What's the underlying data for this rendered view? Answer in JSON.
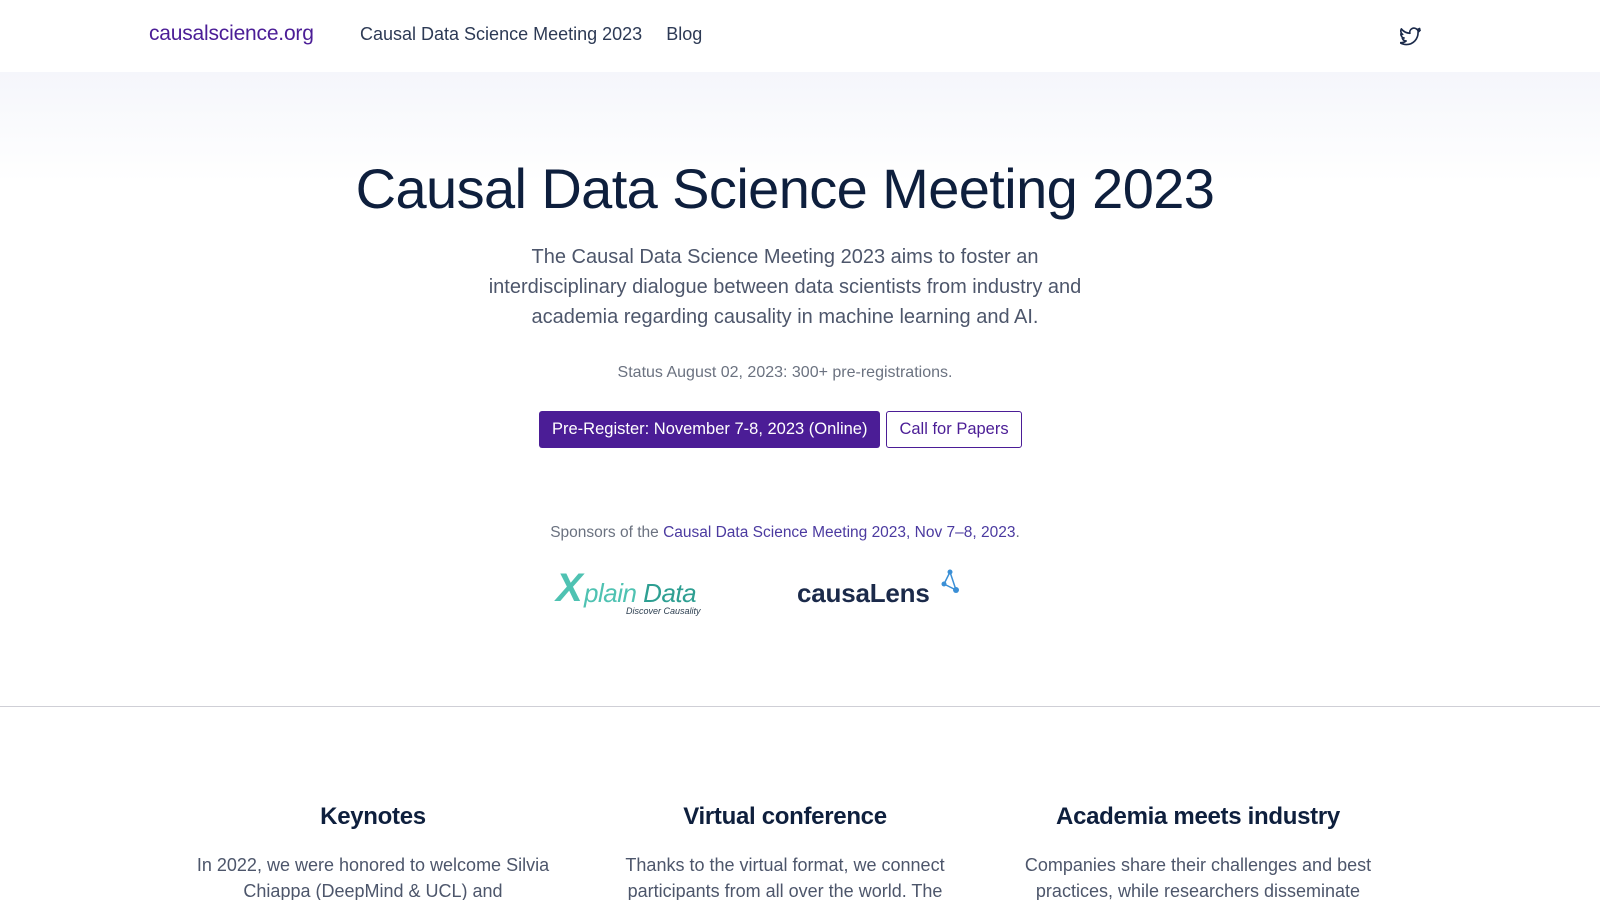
{
  "header": {
    "brand": "causalscience.org",
    "nav": [
      "Causal Data Science Meeting 2023",
      "Blog"
    ],
    "social_icon": "twitter-icon"
  },
  "hero": {
    "title": "Causal Data Science Meeting 2023",
    "description": "The Causal Data Science Meeting 2023 aims to foster an interdisciplinary dialogue between data scientists from industry and academia regarding causality in machine learning and AI.",
    "status": "Status August 02, 2023: 300+ pre-registrations.",
    "primary_button": "Pre-Register: November 7-8, 2023 (Online)",
    "secondary_button": "Call for Papers",
    "sponsors_prefix": "Sponsors of the ",
    "sponsors_link": "Causal Data Science Meeting 2023, Nov 7–8, 2023",
    "sponsors_suffix": "."
  },
  "sponsors": [
    {
      "name": "Xplain Data",
      "x": "X",
      "rest": "plain",
      "data_word": "Data",
      "tagline": "Discover Causality"
    },
    {
      "name": "causaLens",
      "word": "causaLens"
    }
  ],
  "features": [
    {
      "title": "Keynotes",
      "text": "In 2022, we were honored to welcome Silvia Chiappa (DeepMind & UCL) and"
    },
    {
      "title": "Virtual conference",
      "text": "Thanks to the virtual format, we connect participants from all over the world. The"
    },
    {
      "title": "Academia meets industry",
      "text": "Companies share their challenges and best practices, while researchers disseminate"
    }
  ],
  "colors": {
    "brand_purple": "#4b1d96",
    "heading_navy": "#0e1f3d",
    "xplain_teal": "#4fc2b2",
    "causalens_blue": "#3a8fd6"
  }
}
